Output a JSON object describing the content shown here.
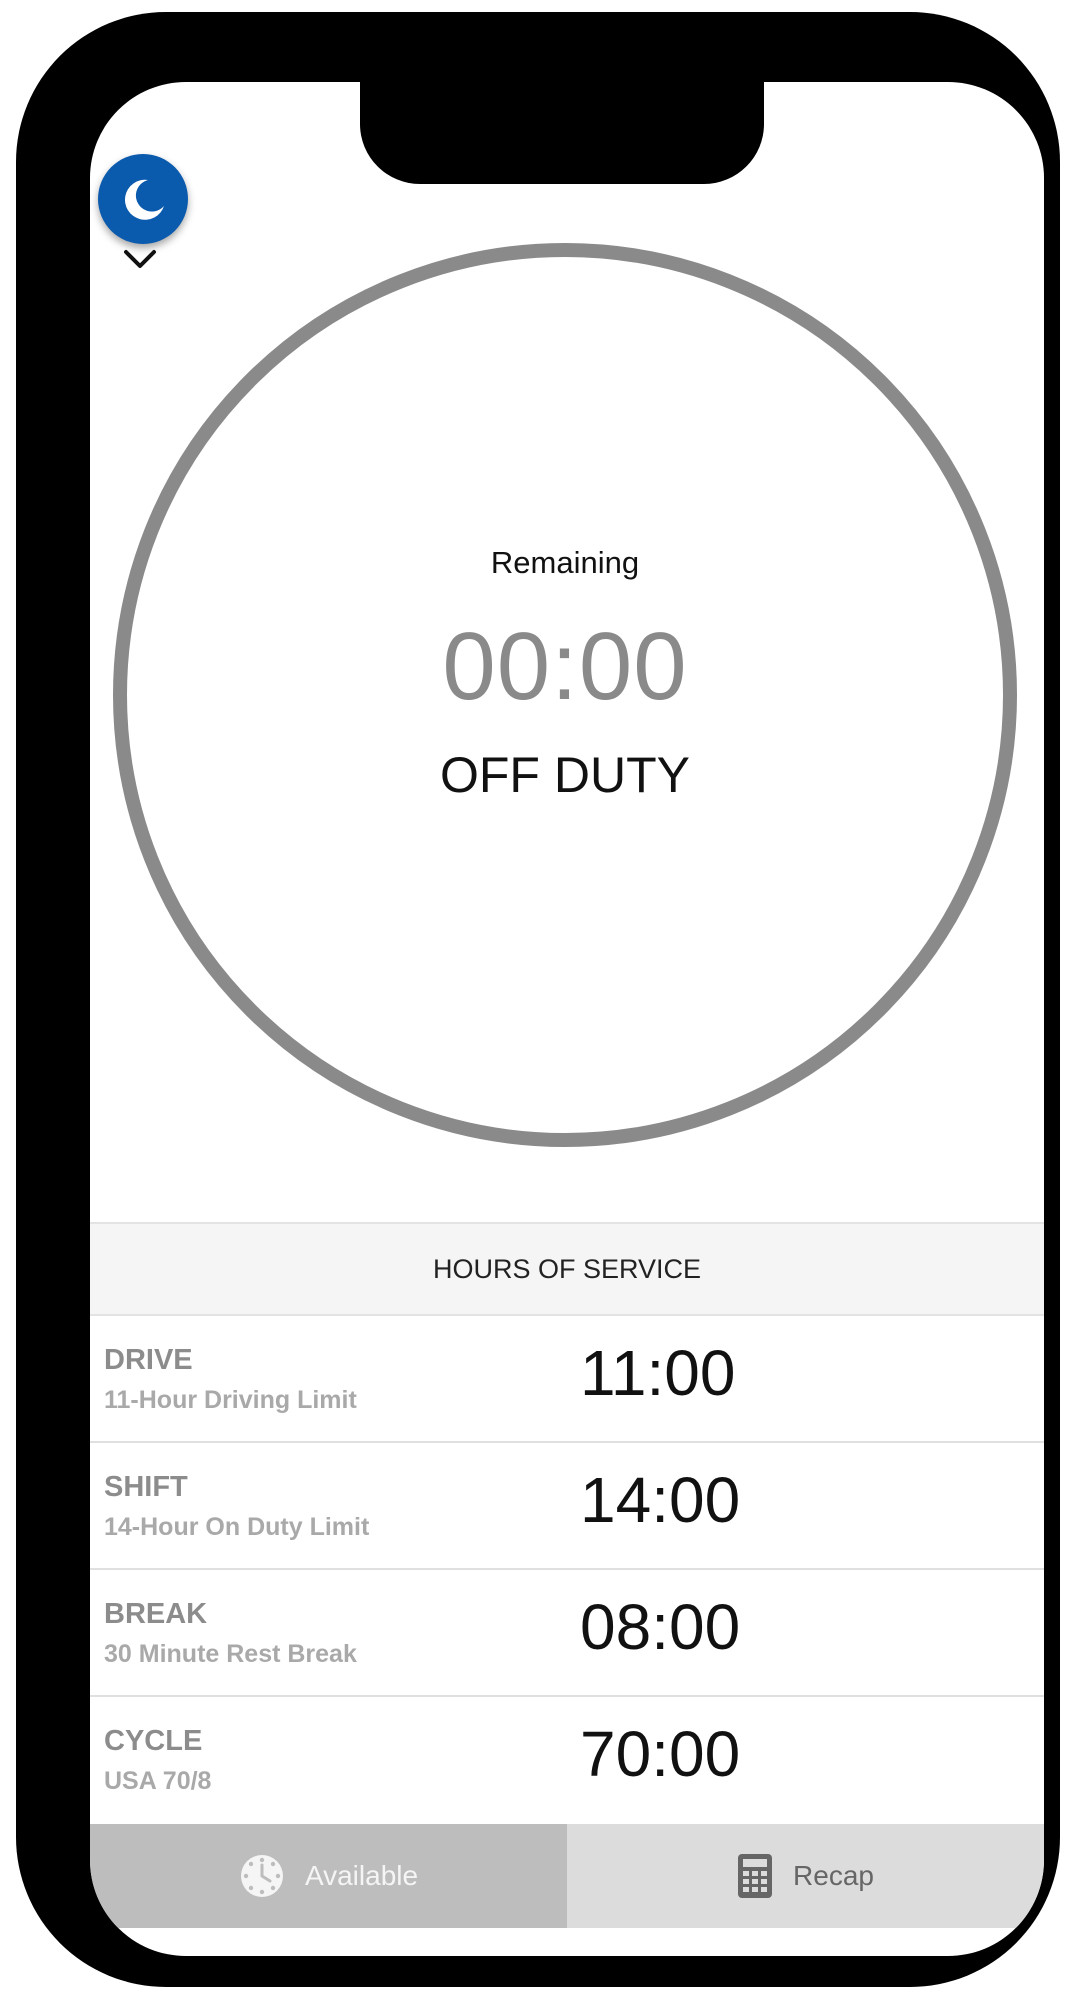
{
  "header": {
    "night_mode_icon": "moon-icon"
  },
  "status": {
    "remaining_label": "Remaining",
    "remaining_time": "00:00",
    "duty_status": "OFF DUTY",
    "expand_icon": "chevron-down-icon"
  },
  "hours_of_service": {
    "title": "HOURS OF SERVICE",
    "rows": [
      {
        "name": "DRIVE",
        "description": "11-Hour Driving Limit",
        "value": "11:00"
      },
      {
        "name": "SHIFT",
        "description": "14-Hour On Duty Limit",
        "value": "14:00"
      },
      {
        "name": "BREAK",
        "description": "30 Minute Rest Break",
        "value": "08:00"
      },
      {
        "name": "CYCLE",
        "description": "USA 70/8",
        "value": "70:00"
      }
    ]
  },
  "tabs": {
    "available": {
      "label": "Available",
      "icon": "clock-icon"
    },
    "recap": {
      "label": "Recap",
      "icon": "calculator-icon"
    }
  },
  "colors": {
    "accent": "#0a5aae",
    "ring": "#8a8a8a",
    "tab_active_bg": "#bdbdbd",
    "tab_inactive_bg": "#dcdcdc"
  }
}
